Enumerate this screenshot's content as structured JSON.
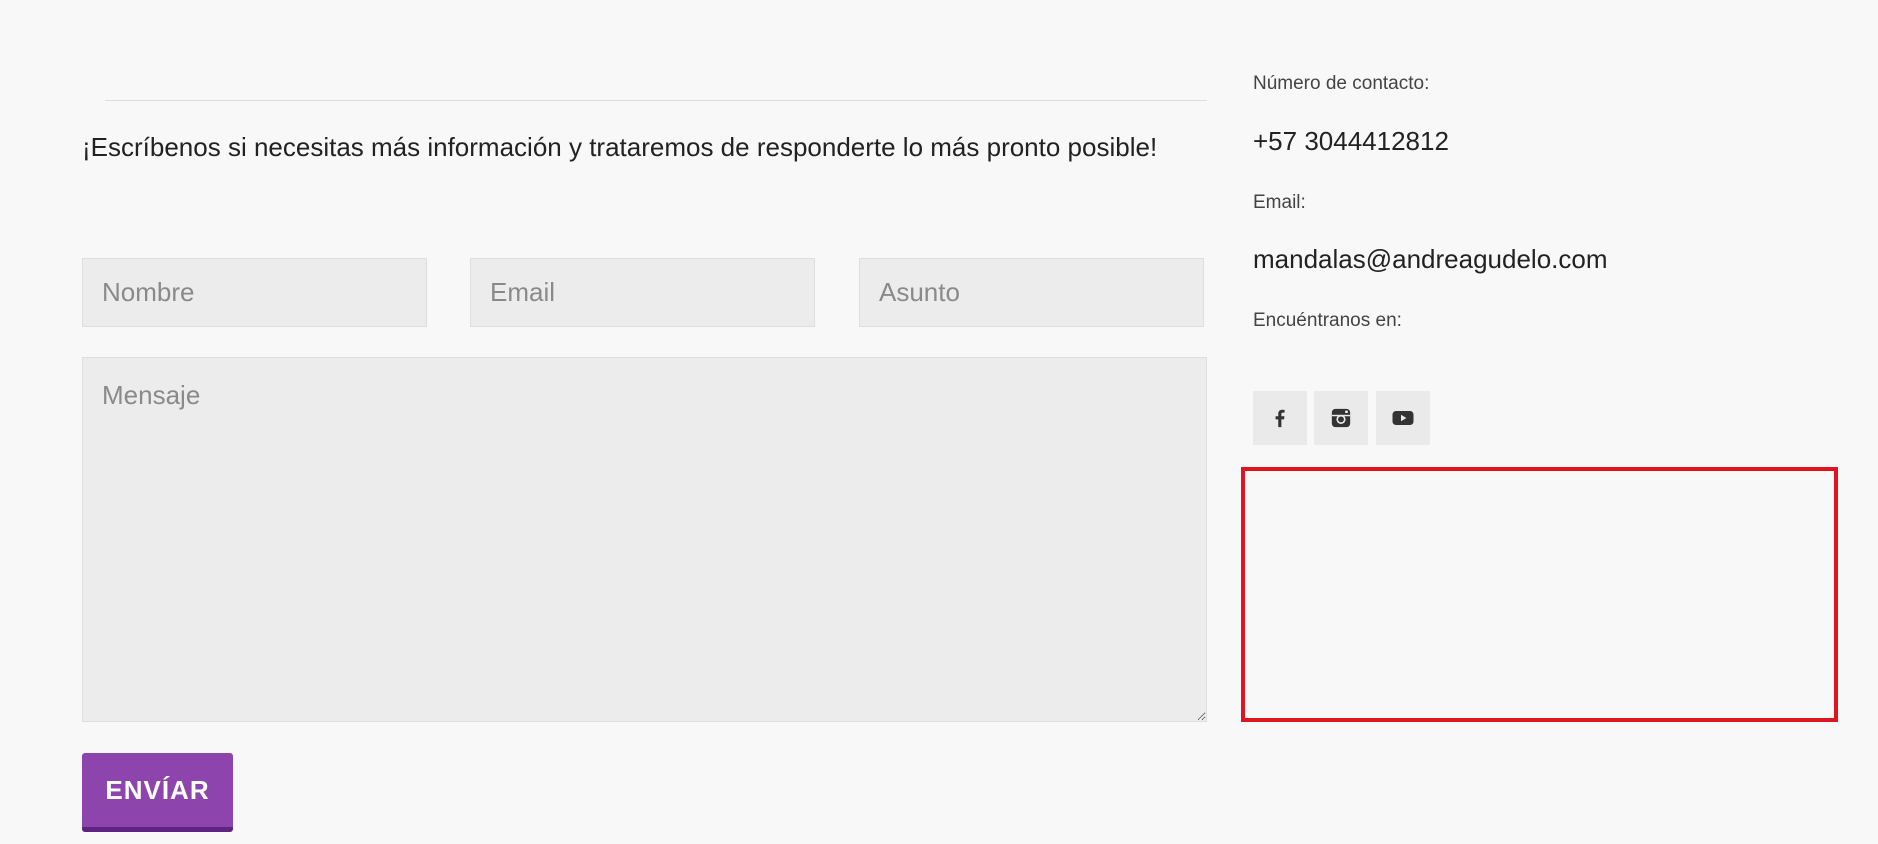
{
  "contact_form": {
    "intro_text": "¡Escríbenos si necesitas más información y trataremos de responderte lo más pronto posible!",
    "name_placeholder": "Nombre",
    "email_placeholder": "Email",
    "subject_placeholder": "Asunto",
    "message_placeholder": "Mensaje",
    "submit_label": "ENVÍAR"
  },
  "contact_info": {
    "phone_label": "Número de contacto:",
    "phone_value": "+57 3044412812",
    "email_label": "Email:",
    "email_value": "mandalas@andreagudelo.com",
    "social_label": "Encuéntranos en:"
  },
  "social_links": [
    {
      "icon": "facebook-icon"
    },
    {
      "icon": "instagram-icon"
    },
    {
      "icon": "youtube-icon"
    }
  ],
  "colors": {
    "page_background": "#f8f8f8",
    "field_background": "#ececec",
    "button_primary": "#8e44ad",
    "button_shadow": "#5e2481",
    "social_icon": "#333333",
    "highlight_border": "#e0141e"
  }
}
